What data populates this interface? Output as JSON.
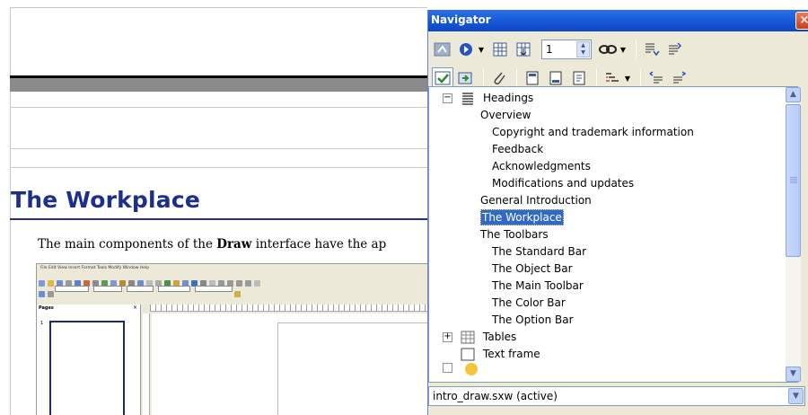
{
  "document": {
    "heading": "The Workplace",
    "body_prefix": "The main components of the ",
    "body_bold": "Draw",
    "body_suffix": " interface have the ap",
    "mini_menu": "File   Edit   View   Insert   Format   Tools   Modify   Window   Help",
    "mini_pages_title": "Pages",
    "mini_close": "×",
    "mini_page_number": "1"
  },
  "navigator": {
    "title": "Navigator",
    "close_glyph": "×",
    "page_number": "1",
    "tree": [
      {
        "label": "Headings",
        "level": 0,
        "expander": "−",
        "icon": "headings-icon"
      },
      {
        "label": "Overview",
        "level": 1
      },
      {
        "label": "Copyright and trademark information",
        "level": 2
      },
      {
        "label": "Feedback",
        "level": 2
      },
      {
        "label": "Acknowledgments",
        "level": 2
      },
      {
        "label": "Modifications and updates",
        "level": 2
      },
      {
        "label": "General Introduction",
        "level": 1
      },
      {
        "label": "The Workplace",
        "level": 1,
        "selected": true
      },
      {
        "label": "The Toolbars",
        "level": 1
      },
      {
        "label": "The Standard Bar",
        "level": 2
      },
      {
        "label": "The Object Bar",
        "level": 2
      },
      {
        "label": "The Main Toolbar",
        "level": 2
      },
      {
        "label": "The Color Bar",
        "level": 2
      },
      {
        "label": "The Option Bar",
        "level": 2
      },
      {
        "label": "Tables",
        "level": 0,
        "expander": "+",
        "icon": "table-icon"
      },
      {
        "label": "Text frame",
        "level": 0,
        "icon": "text-frame-icon"
      }
    ],
    "document_select": "intro_draw.sxw (active)"
  },
  "colors": {
    "heading_blue": "#1d2f8c",
    "selection_blue": "#316ac5",
    "titlebar_blue": "#1555d6"
  }
}
